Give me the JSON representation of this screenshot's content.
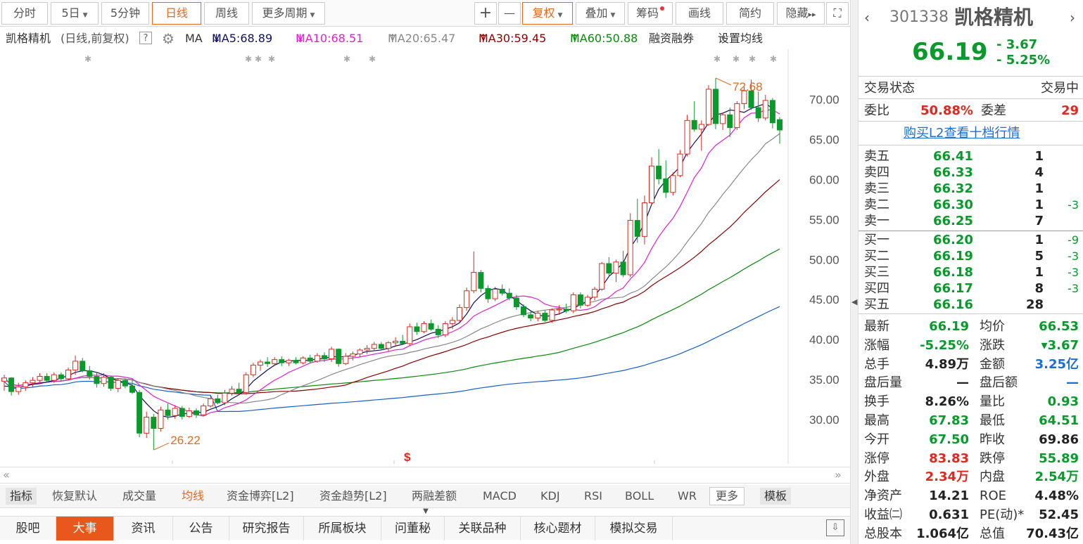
{
  "toolbar": {
    "tabs": [
      "分时",
      "5日",
      "5分钟",
      "日线",
      "周线",
      "更多周期"
    ],
    "plus": "+",
    "minus": "—",
    "fuquan": "复权",
    "diejia": "叠加",
    "chouma": "筹码",
    "huaxian": "画线",
    "jianyue": "简约",
    "yincang": "隐藏",
    "more_arrows": "▸▸",
    "expand_icon": "⛶"
  },
  "legend": {
    "name": "凯格精机",
    "period": "(日线,前复权)",
    "help": "?",
    "ma": "MA",
    "ma5": "MA5:68.89",
    "ma10": "MA10:68.51",
    "ma20": "MA20:65.47",
    "ma30": "MA30:59.45",
    "ma60": "MA60:50.88",
    "ma5_arrow": "↓",
    "ma10_arrow": "↓",
    "ma20_arrow": "↑",
    "ma30_arrow": "↑",
    "ma60_arrow": "↑",
    "rongzi": "融资融券",
    "setting": "设置均线"
  },
  "chart_data": {
    "type": "candlestick",
    "y_ticks": [
      "70.00",
      "65.00",
      "60.00",
      "55.00",
      "50.00",
      "45.00",
      "40.00",
      "35.00",
      "30.00"
    ],
    "ylim": [
      24.9,
      75.6
    ],
    "high_label": "72.68",
    "low_label": "26.22",
    "event_marker": "$",
    "ohlc": [
      [
        34.8,
        35.6,
        33.6,
        35.2
      ],
      [
        35.2,
        35.3,
        33.0,
        33.5
      ],
      [
        33.5,
        34.6,
        33.1,
        34.1
      ],
      [
        34.1,
        34.9,
        33.6,
        34.6
      ],
      [
        34.6,
        35.3,
        34.1,
        34.9
      ],
      [
        34.9,
        35.8,
        34.5,
        35.4
      ],
      [
        35.4,
        35.8,
        34.7,
        34.9
      ],
      [
        34.9,
        35.9,
        34.6,
        35.6
      ],
      [
        35.6,
        35.9,
        34.8,
        35.1
      ],
      [
        35.1,
        36.5,
        34.9,
        36.2
      ],
      [
        36.2,
        38.0,
        35.6,
        37.3
      ],
      [
        37.3,
        37.7,
        35.9,
        36.1
      ],
      [
        36.1,
        36.7,
        35.0,
        35.4
      ],
      [
        35.4,
        35.9,
        34.0,
        34.5
      ],
      [
        34.5,
        35.8,
        34.1,
        35.3
      ],
      [
        35.3,
        35.5,
        33.6,
        33.9
      ],
      [
        33.9,
        35.2,
        33.4,
        34.9
      ],
      [
        34.9,
        35.1,
        33.9,
        34.2
      ],
      [
        34.2,
        35.0,
        33.2,
        33.4
      ],
      [
        33.4,
        33.7,
        27.8,
        28.3
      ],
      [
        28.3,
        31.0,
        27.7,
        30.3
      ],
      [
        30.3,
        30.7,
        26.2,
        28.9
      ],
      [
        28.9,
        31.6,
        28.5,
        31.2
      ],
      [
        31.2,
        32.0,
        30.0,
        30.5
      ],
      [
        30.5,
        31.8,
        30.1,
        31.4
      ],
      [
        31.4,
        31.7,
        30.0,
        30.4
      ],
      [
        30.4,
        31.5,
        30.2,
        31.1
      ],
      [
        31.1,
        31.4,
        30.2,
        30.6
      ],
      [
        30.6,
        32.0,
        30.4,
        31.7
      ],
      [
        31.7,
        33.0,
        31.5,
        32.6
      ],
      [
        32.6,
        33.1,
        31.9,
        32.1
      ],
      [
        32.1,
        33.7,
        31.8,
        33.3
      ],
      [
        33.3,
        34.2,
        33.0,
        33.8
      ],
      [
        33.8,
        34.6,
        33.1,
        33.4
      ],
      [
        33.4,
        35.9,
        33.1,
        35.6
      ],
      [
        35.6,
        37.1,
        35.3,
        36.8
      ],
      [
        36.8,
        37.5,
        36.1,
        37.2
      ],
      [
        37.2,
        37.8,
        36.6,
        37.0
      ],
      [
        37.0,
        37.8,
        36.8,
        37.5
      ],
      [
        37.5,
        37.9,
        36.7,
        37.1
      ],
      [
        37.1,
        37.6,
        36.7,
        37.4
      ],
      [
        37.4,
        37.8,
        36.9,
        37.1
      ],
      [
        37.1,
        37.9,
        36.9,
        37.7
      ],
      [
        37.7,
        38.1,
        37.0,
        37.3
      ],
      [
        37.3,
        38.3,
        37.1,
        38.0
      ],
      [
        38.0,
        38.4,
        37.2,
        37.6
      ],
      [
        37.6,
        39.1,
        37.2,
        38.8
      ],
      [
        38.8,
        38.9,
        36.6,
        37.0
      ],
      [
        37.0,
        38.3,
        36.8,
        37.9
      ],
      [
        37.9,
        38.5,
        37.4,
        38.2
      ],
      [
        38.2,
        38.9,
        37.8,
        38.7
      ],
      [
        38.7,
        39.3,
        38.2,
        38.9
      ],
      [
        38.9,
        39.7,
        38.6,
        39.4
      ],
      [
        39.4,
        39.7,
        38.7,
        38.9
      ],
      [
        38.9,
        39.8,
        38.5,
        39.6
      ],
      [
        39.6,
        40.3,
        39.1,
        39.8
      ],
      [
        39.8,
        40.6,
        39.3,
        39.5
      ],
      [
        39.5,
        42.0,
        39.2,
        41.6
      ],
      [
        41.6,
        42.1,
        40.6,
        41.0
      ],
      [
        41.0,
        42.3,
        40.8,
        42.0
      ],
      [
        42.0,
        42.5,
        41.1,
        41.3
      ],
      [
        41.3,
        41.8,
        40.2,
        40.6
      ],
      [
        40.6,
        42.3,
        40.3,
        42.0
      ],
      [
        42.0,
        42.8,
        41.3,
        42.4
      ],
      [
        42.4,
        44.4,
        42.1,
        44.0
      ],
      [
        44.0,
        46.5,
        43.6,
        46.1
      ],
      [
        46.1,
        51.0,
        45.8,
        48.4
      ],
      [
        48.4,
        48.7,
        45.9,
        46.4
      ],
      [
        46.4,
        46.8,
        44.6,
        45.1
      ],
      [
        45.1,
        46.6,
        44.8,
        46.3
      ],
      [
        46.3,
        46.9,
        45.5,
        45.8
      ],
      [
        45.8,
        46.4,
        44.9,
        45.2
      ],
      [
        45.2,
        45.6,
        43.7,
        44.1
      ],
      [
        44.1,
        44.4,
        42.8,
        43.1
      ],
      [
        43.1,
        43.6,
        42.3,
        42.7
      ],
      [
        42.7,
        43.6,
        42.3,
        43.3
      ],
      [
        43.3,
        43.7,
        42.2,
        42.4
      ],
      [
        42.4,
        43.9,
        42.1,
        43.7
      ],
      [
        43.7,
        44.3,
        43.1,
        43.8
      ],
      [
        43.8,
        44.5,
        43.3,
        43.6
      ],
      [
        43.6,
        45.9,
        43.3,
        45.6
      ],
      [
        45.6,
        45.9,
        43.9,
        44.3
      ],
      [
        44.3,
        45.6,
        44.1,
        45.3
      ],
      [
        45.3,
        46.6,
        44.9,
        46.3
      ],
      [
        46.3,
        49.7,
        46.1,
        49.5
      ],
      [
        49.5,
        50.3,
        47.9,
        48.3
      ],
      [
        48.3,
        50.0,
        47.2,
        49.7
      ],
      [
        49.7,
        51.1,
        47.8,
        48.1
      ],
      [
        48.1,
        55.8,
        47.8,
        54.9
      ],
      [
        54.9,
        57.6,
        52.1,
        52.9
      ],
      [
        52.9,
        58.0,
        51.9,
        57.1
      ],
      [
        57.1,
        62.8,
        56.8,
        61.7
      ],
      [
        61.7,
        63.8,
        59.4,
        60.1
      ],
      [
        60.1,
        62.4,
        57.7,
        58.4
      ],
      [
        58.4,
        60.9,
        58.0,
        60.5
      ],
      [
        60.5,
        63.7,
        60.3,
        63.2
      ],
      [
        63.2,
        68.1,
        62.9,
        67.4
      ],
      [
        67.4,
        69.8,
        66.0,
        66.3
      ],
      [
        66.3,
        67.4,
        63.6,
        66.9
      ],
      [
        66.9,
        71.8,
        66.7,
        71.3
      ],
      [
        71.3,
        72.7,
        66.3,
        67.0
      ],
      [
        67.0,
        68.4,
        66.2,
        68.1
      ],
      [
        68.1,
        69.0,
        65.3,
        66.5
      ],
      [
        66.5,
        69.8,
        66.2,
        69.5
      ],
      [
        69.5,
        71.6,
        68.8,
        71.1
      ],
      [
        71.1,
        72.5,
        68.7,
        69.0
      ],
      [
        69.0,
        71.0,
        67.2,
        67.7
      ],
      [
        67.7,
        70.6,
        67.4,
        69.9
      ],
      [
        69.9,
        70.2,
        66.4,
        67.1
      ],
      [
        67.5,
        67.8,
        64.5,
        66.2
      ]
    ],
    "ma5": [
      34.2,
      34.1,
      34.0,
      34.2,
      34.4,
      34.5,
      34.7,
      34.9,
      35.2,
      35.5,
      35.9,
      36.1,
      36.1,
      35.9,
      35.6,
      35.1,
      34.9,
      34.6,
      34.3,
      33.0,
      32.0,
      31.1,
      30.5,
      30.3,
      30.4,
      30.7,
      30.8,
      30.9,
      30.9,
      31.3,
      31.6,
      32.0,
      32.6,
      33.1,
      33.8,
      34.8,
      35.5,
      36.2,
      36.8,
      37.2,
      37.3,
      37.4,
      37.4,
      37.4,
      37.6,
      37.6,
      37.9,
      37.8,
      37.9,
      38.0,
      38.3,
      38.5,
      38.6,
      38.7,
      38.9,
      39.2,
      39.4,
      39.7,
      40.0,
      40.4,
      40.8,
      41.0,
      41.3,
      41.6,
      42.1,
      43.2,
      44.6,
      45.5,
      46.1,
      46.4,
      46.2,
      45.5,
      44.9,
      44.2,
      43.6,
      43.1,
      42.9,
      43.0,
      43.2,
      43.6,
      43.9,
      44.4,
      44.8,
      45.5,
      46.6,
      47.9,
      48.7,
      49.6,
      51.5,
      52.8,
      54.6,
      56.9,
      58.8,
      59.9,
      60.7,
      61.6,
      63.4,
      64.6,
      65.7,
      67.1,
      68.1,
      68.3,
      68.7,
      68.6,
      68.4,
      68.9,
      69.2,
      69.5,
      68.9
    ]
  },
  "scrollbar": {
    "left_arrow": "«",
    "right_arrow": "»"
  },
  "indicators": {
    "items": [
      "指标",
      "恢复默认",
      "成交量",
      "均线",
      "资金博弈[L2]",
      "资金趋势[L2]",
      "两融差额",
      "MACD",
      "KDJ",
      "RSI",
      "BOLL",
      "WR",
      "更多",
      "模板"
    ]
  },
  "bottom_tabs": [
    "股吧",
    "大事",
    "资讯",
    "公告",
    "研究报告",
    "所属板块",
    "问董秘",
    "关联品种",
    "核心题材",
    "模拟交易"
  ],
  "quote": {
    "code": "301338",
    "name": "凯格精机",
    "price": "66.19",
    "change": "- 3.67",
    "change_pct": "- 5.25%",
    "status_label": "交易状态",
    "status_value": "交易中",
    "weibi_label": "委比",
    "weibi_value": "50.88%",
    "weicha_label": "委差",
    "weicha_value": "29",
    "l2_link": "购买L2查看十档行情",
    "sells": [
      {
        "label": "卖五",
        "price": "66.41",
        "vol": "1",
        "chg": ""
      },
      {
        "label": "卖四",
        "price": "66.33",
        "vol": "4",
        "chg": ""
      },
      {
        "label": "卖三",
        "price": "66.32",
        "vol": "1",
        "chg": ""
      },
      {
        "label": "卖二",
        "price": "66.30",
        "vol": "1",
        "chg": "-3"
      },
      {
        "label": "卖一",
        "price": "66.25",
        "vol": "7",
        "chg": ""
      }
    ],
    "buys": [
      {
        "label": "买一",
        "price": "66.20",
        "vol": "1",
        "chg": "-9"
      },
      {
        "label": "买二",
        "price": "66.19",
        "vol": "5",
        "chg": "-3"
      },
      {
        "label": "买三",
        "price": "66.18",
        "vol": "1",
        "chg": "-3"
      },
      {
        "label": "买四",
        "price": "66.17",
        "vol": "8",
        "chg": "-3"
      },
      {
        "label": "买五",
        "price": "66.16",
        "vol": "28",
        "chg": ""
      }
    ],
    "stats": [
      {
        "l1": "最新",
        "v1": "66.19",
        "c1": "green",
        "l2": "均价",
        "v2": "66.53",
        "c2": "green"
      },
      {
        "l1": "涨幅",
        "v1": "-5.25%",
        "c1": "green",
        "l2": "涨跌",
        "v2": "▾3.67",
        "c2": "green"
      },
      {
        "l1": "总手",
        "v1": "4.89万",
        "c1": "dark",
        "l2": "金额",
        "v2": "3.25亿",
        "c2": "blue"
      },
      {
        "l1": "盘后量",
        "v1": "—",
        "c1": "dark",
        "l2": "盘后额",
        "v2": "—",
        "c2": "blue"
      },
      {
        "l1": "换手",
        "v1": "8.26%",
        "c1": "dark",
        "l2": "量比",
        "v2": "0.93",
        "c2": "green"
      },
      {
        "l1": "最高",
        "v1": "67.83",
        "c1": "green",
        "l2": "最低",
        "v2": "64.51",
        "c2": "green"
      },
      {
        "l1": "今开",
        "v1": "67.50",
        "c1": "green",
        "l2": "昨收",
        "v2": "69.86",
        "c2": "dark"
      },
      {
        "l1": "涨停",
        "v1": "83.83",
        "c1": "red",
        "l2": "跌停",
        "v2": "55.89",
        "c2": "green"
      },
      {
        "l1": "外盘",
        "v1": "2.34万",
        "c1": "red",
        "l2": "内盘",
        "v2": "2.54万",
        "c2": "green"
      },
      {
        "l1": "净资产",
        "v1": "14.21",
        "c1": "dark",
        "l2": "ROE",
        "v2": "4.48%",
        "c2": "dark"
      },
      {
        "l1": "收益㈡",
        "v1": "0.631",
        "c1": "dark",
        "l2": "PE(动)*",
        "v2": "52.45",
        "c2": "dark"
      },
      {
        "l1": "总股本",
        "v1": "1.064亿",
        "c1": "dark",
        "l2": "总值",
        "v2": "70.43亿",
        "c2": "dark"
      }
    ]
  },
  "colors": {
    "up": "#e0281f",
    "down": "#0a9a2c",
    "ma5": "#101060",
    "ma10": "#e020d0",
    "ma20": "#888888",
    "ma30": "#8b0000",
    "ma60": "#0a8a0a",
    "ma_long": "#1560c8",
    "accent": "#e36a1e"
  }
}
